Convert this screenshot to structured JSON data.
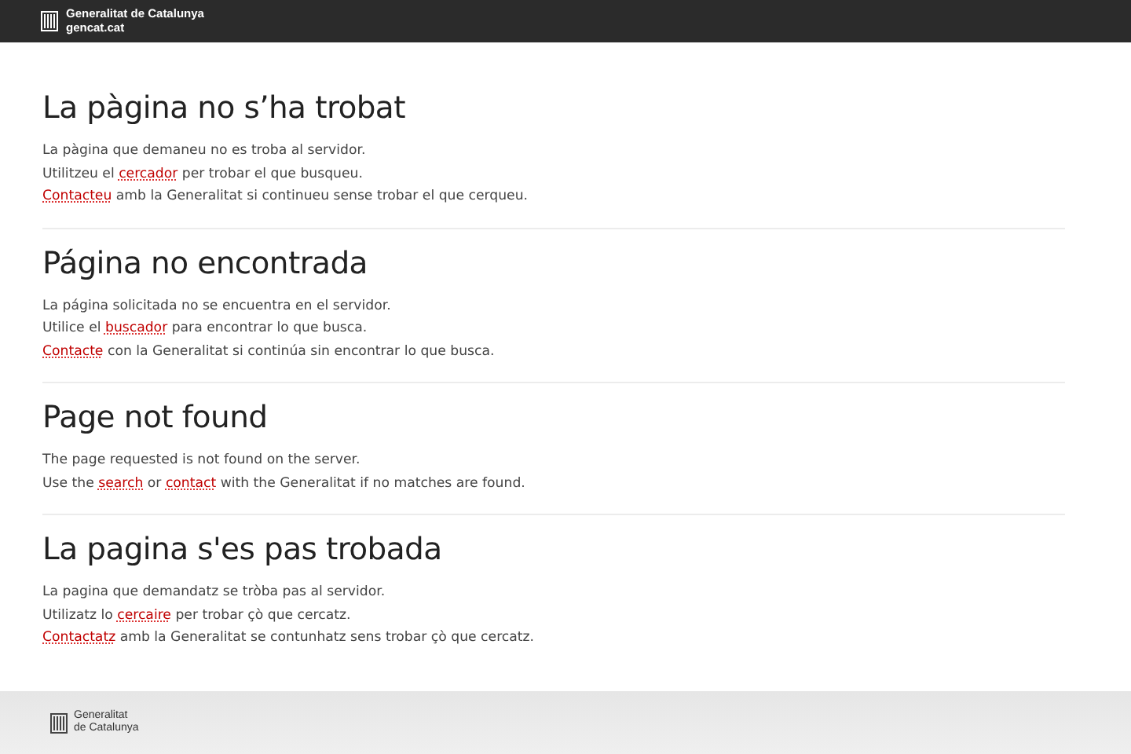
{
  "header": {
    "brand": "Generalitat de Catalunya",
    "domain": "gencat.cat"
  },
  "sections": [
    {
      "title": "La pàgina no s’ha trobat",
      "lines": [
        [
          {
            "kind": "text",
            "text": "La pàgina que demaneu no es troba al servidor."
          }
        ],
        [
          {
            "kind": "text",
            "text": "Utilitzeu el "
          },
          {
            "kind": "link",
            "text": "cercador"
          },
          {
            "kind": "text",
            "text": " per trobar el que busqueu."
          }
        ],
        [
          {
            "kind": "link",
            "text": "Contacteu"
          },
          {
            "kind": "text",
            "text": " amb la Generalitat si continueu sense trobar el que cerqueu."
          }
        ]
      ]
    },
    {
      "title": "Página no encontrada",
      "lines": [
        [
          {
            "kind": "text",
            "text": "La página solicitada no se encuentra en el servidor."
          }
        ],
        [
          {
            "kind": "text",
            "text": "Utilice el "
          },
          {
            "kind": "link",
            "text": "buscador"
          },
          {
            "kind": "text",
            "text": " para encontrar lo que busca."
          }
        ],
        [
          {
            "kind": "link",
            "text": "Contacte"
          },
          {
            "kind": "text",
            "text": " con la Generalitat si continúa sin encontrar lo que busca."
          }
        ]
      ]
    },
    {
      "title": "Page not found",
      "lines": [
        [
          {
            "kind": "text",
            "text": "The page requested is not found on the server."
          }
        ],
        [
          {
            "kind": "text",
            "text": "Use the "
          },
          {
            "kind": "link",
            "text": "search"
          },
          {
            "kind": "text",
            "text": " or "
          },
          {
            "kind": "link",
            "text": "contact"
          },
          {
            "kind": "text",
            "text": " with the Generalitat if no matches are found."
          }
        ]
      ]
    },
    {
      "title": "La pagina s'es pas trobada",
      "lines": [
        [
          {
            "kind": "text",
            "text": "La pagina que demandatz se tròba pas al servidor."
          }
        ],
        [
          {
            "kind": "text",
            "text": "Utilizatz lo "
          },
          {
            "kind": "link",
            "text": "cercaire"
          },
          {
            "kind": "text",
            "text": " per trobar çò que cercatz."
          }
        ],
        [
          {
            "kind": "link",
            "text": "Contactatz"
          },
          {
            "kind": "text",
            "text": " amb la Generalitat se contunhatz sens trobar çò que cercatz."
          }
        ]
      ]
    }
  ],
  "footer": {
    "brand_lines": [
      "Generalitat",
      "de Catalunya"
    ]
  }
}
